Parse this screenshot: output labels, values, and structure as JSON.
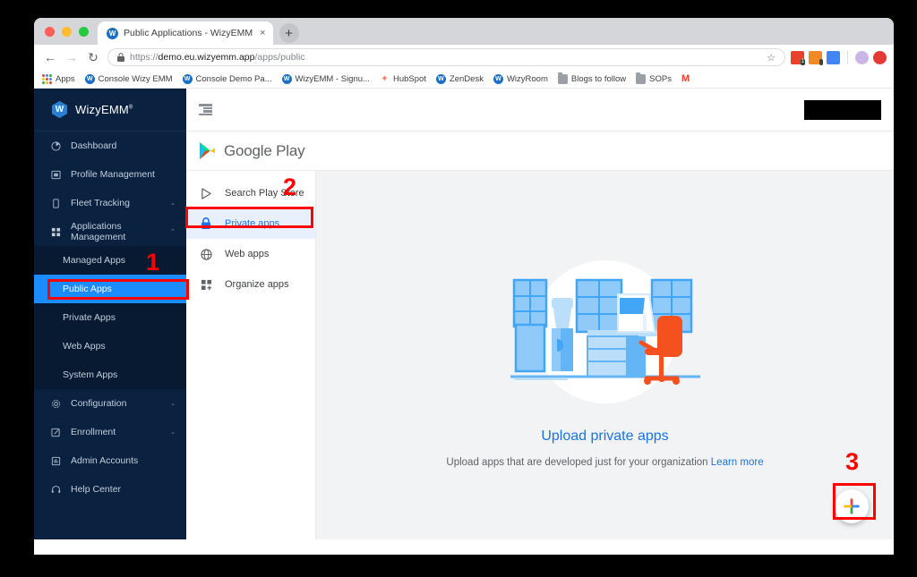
{
  "browser": {
    "tab": {
      "title": "Public Applications - WizyEMM",
      "favicon": "wizyemm-favicon",
      "close_label": "×"
    },
    "new_tab_label": "+",
    "nav": {
      "back": "←",
      "forward": "→",
      "reload": "↻"
    },
    "omnibox": {
      "lock_icon": "lock-icon",
      "scheme": "https://",
      "host": "demo.eu.wizyemm.app",
      "path": "/apps/public",
      "star_icon": "star-icon"
    },
    "bookmarks": [
      {
        "label": "Apps",
        "icon": "apps-grid-icon"
      },
      {
        "label": "Console Wizy EMM",
        "icon": "wizyemm-favicon"
      },
      {
        "label": "Console Demo Pa...",
        "icon": "wizyemm-favicon"
      },
      {
        "label": "WizyEMM - Signu...",
        "icon": "wizyemm-favicon"
      },
      {
        "label": "HubSpot",
        "icon": "hubspot-icon"
      },
      {
        "label": "ZenDesk",
        "icon": "wizyemm-favicon"
      },
      {
        "label": "WizyRoom",
        "icon": "wizyemm-favicon"
      },
      {
        "label": "Blogs to follow",
        "icon": "folder-icon"
      },
      {
        "label": "SOPs",
        "icon": "folder-icon"
      },
      {
        "label": "M",
        "icon": "gmail-icon"
      }
    ]
  },
  "sidebar": {
    "brand": {
      "mark": "W",
      "name": "WizyEMM",
      "trademark": "®"
    },
    "items": [
      {
        "label": "Dashboard",
        "icon": "pie-chart-icon",
        "expandable": false
      },
      {
        "label": "Profile Management",
        "icon": "id-card-icon",
        "expandable": false
      },
      {
        "label": "Fleet Tracking",
        "icon": "phone-icon",
        "expandable": true,
        "chevron": "⌄"
      },
      {
        "label": "Applications Management",
        "icon": "grid-icon",
        "expandable": true,
        "chevron": "⌃"
      }
    ],
    "subitems": [
      {
        "label": "Managed Apps",
        "active": false
      },
      {
        "label": "Public Apps",
        "active": true
      },
      {
        "label": "Private Apps",
        "active": false
      },
      {
        "label": "Web Apps",
        "active": false
      },
      {
        "label": "System Apps",
        "active": false
      }
    ],
    "items_bottom": [
      {
        "label": "Configuration",
        "icon": "gear-icon",
        "expandable": true,
        "chevron": "⌄"
      },
      {
        "label": "Enrollment",
        "icon": "edit-square-icon",
        "expandable": true,
        "chevron": "⌄"
      },
      {
        "label": "Admin Accounts",
        "icon": "admin-icon",
        "expandable": false
      },
      {
        "label": "Help Center",
        "icon": "headset-icon",
        "expandable": false
      }
    ]
  },
  "topbar": {
    "collapse_icon": "collapse-sidebar-icon",
    "account_redacted": ""
  },
  "play": {
    "logo_icon": "google-play-icon",
    "title": "Google Play",
    "menu": [
      {
        "label": "Search Play Store",
        "icon": "play-triangle-icon",
        "selected": false
      },
      {
        "label": "Private apps",
        "icon": "lock-icon",
        "selected": true
      },
      {
        "label": "Web apps",
        "icon": "globe-icon",
        "selected": false
      },
      {
        "label": "Organize apps",
        "icon": "organize-grid-icon",
        "selected": false
      }
    ]
  },
  "content": {
    "illustration": "office-workspace-illustration",
    "title": "Upload private apps",
    "subtitle": "Upload apps that are developed just for your organization",
    "link": "Learn more",
    "fab": {
      "icon": "google-plus-add-icon",
      "label": "+"
    }
  },
  "annotations": [
    {
      "number": "1",
      "target": "public-apps-sidebar-item"
    },
    {
      "number": "2",
      "target": "private-apps-play-menu-item"
    },
    {
      "number": "3",
      "target": "add-private-app-fab"
    }
  ],
  "colors": {
    "accent_blue": "#1a73e8",
    "sidebar_bg": "#0a2240",
    "active_blue": "#1a8cff",
    "annotation_red": "#ff0000",
    "content_bg": "#f1f3f4"
  }
}
